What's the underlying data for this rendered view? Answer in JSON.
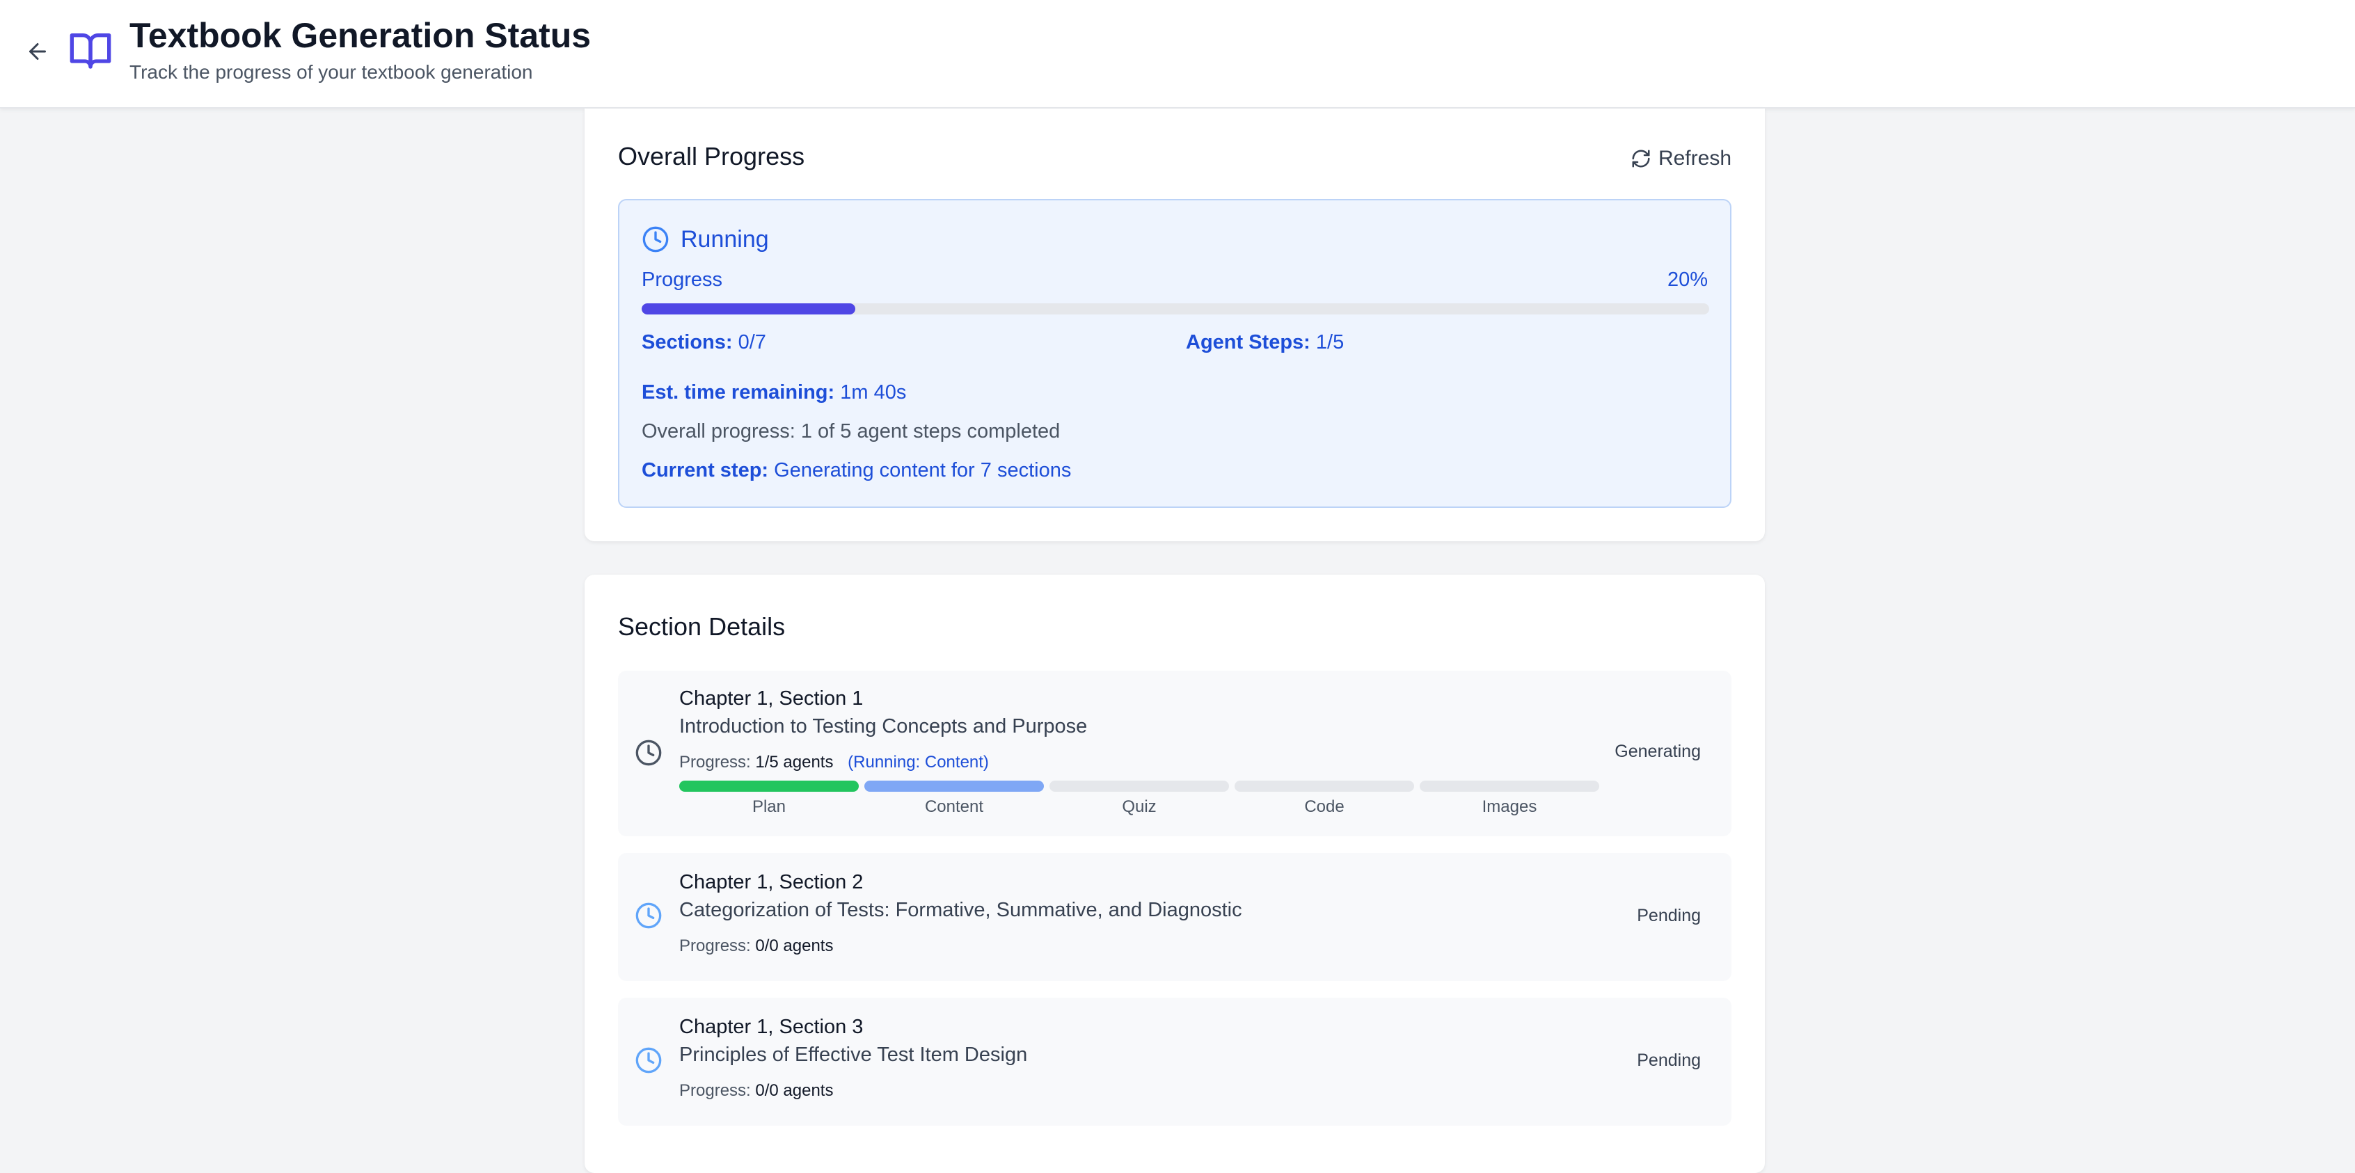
{
  "header": {
    "title": "Textbook Generation Status",
    "subtitle": "Track the progress of your textbook generation"
  },
  "overall": {
    "title": "Overall Progress",
    "refresh_label": "Refresh",
    "status": "Running",
    "progress_label": "Progress",
    "progress_percent_text": "20%",
    "progress_fraction": 0.2,
    "sections_key": "Sections:",
    "sections_value": "0/7",
    "agent_steps_key": "Agent Steps:",
    "agent_steps_value": "1/5",
    "est_time_key": "Est. time remaining:",
    "est_time_value": "1m 40s",
    "overall_text": "Overall progress: 1 of 5 agent steps completed",
    "current_step_key": "Current step:",
    "current_step_value": "Generating content for 7 sections",
    "colors": {
      "accent": "#4f46e5",
      "text_blue": "#1d4ed8",
      "panel_bg": "#eef4fe"
    }
  },
  "sections": {
    "title": "Section Details",
    "items": [
      {
        "title": "Chapter 1, Section 1",
        "subtitle": "Introduction to Testing Concepts and Purpose",
        "progress_key": "Progress:",
        "progress_value": "1/5 agents",
        "running_text": "(Running: Content)",
        "status": "Generating",
        "icon": "clock-icon",
        "agents": [
          {
            "label": "Plan",
            "state": "done",
            "color": "#22c55e"
          },
          {
            "label": "Content",
            "state": "running",
            "color": "#7fa7f5"
          },
          {
            "label": "Quiz",
            "state": "pending",
            "color": "#e5e7eb"
          },
          {
            "label": "Code",
            "state": "pending",
            "color": "#e5e7eb"
          },
          {
            "label": "Images",
            "state": "pending",
            "color": "#e5e7eb"
          }
        ]
      },
      {
        "title": "Chapter 1, Section 2",
        "subtitle": "Categorization of Tests: Formative, Summative, and Diagnostic",
        "progress_key": "Progress:",
        "progress_value": "0/0 agents",
        "status": "Pending",
        "icon": "clock-icon"
      },
      {
        "title": "Chapter 1, Section 3",
        "subtitle": "Principles of Effective Test Item Design",
        "progress_key": "Progress:",
        "progress_value": "0/0 agents",
        "status": "Pending",
        "icon": "clock-icon"
      }
    ]
  }
}
